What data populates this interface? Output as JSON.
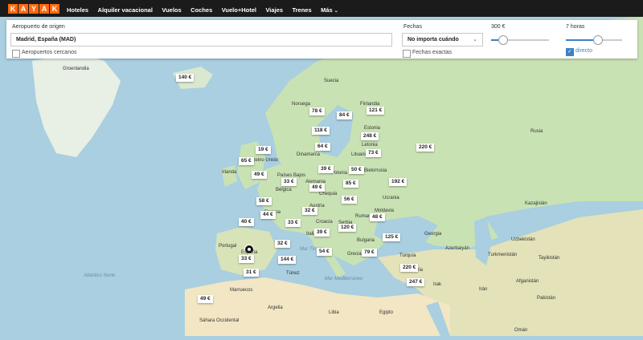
{
  "brand": {
    "letters": [
      "K",
      "A",
      "Y",
      "A",
      "K"
    ]
  },
  "nav": [
    {
      "label": "Hoteles"
    },
    {
      "label": "Alquiler vacacional"
    },
    {
      "label": "Vuelos"
    },
    {
      "label": "Coches"
    },
    {
      "label": "Vuelo+Hotel"
    },
    {
      "label": "Viajes"
    },
    {
      "label": "Trenes"
    },
    {
      "label": "Más"
    }
  ],
  "search": {
    "origin_label": "Aeropuerto de origen",
    "origin_value": "Madrid, España (MAD)",
    "nearby_label": "Aeropuertos cercanos",
    "dates_label": "Fechas",
    "dates_value": "No importa cuándo",
    "exact_dates_label": "Fechas exactas",
    "price_label": "300 €",
    "price_level": 0.2,
    "duration_label": "7 horas",
    "duration_level": 0.55,
    "direct_label": "directo",
    "direct_checked": true
  },
  "colors": {
    "accent": "#ff690f",
    "link": "#3b82c4",
    "water": "#a9cfe0",
    "land": "#c9e2b3",
    "desert": "#f2e6c4"
  },
  "map": {
    "prices": [
      "140 €",
      "78 €",
      "84 €",
      "121 €",
      "118 €",
      "248 €",
      "64 €",
      "73 €",
      "220 €",
      "19 €",
      "65 €",
      "49 €",
      "39 €",
      "50 €",
      "33 €",
      "49 €",
      "85 €",
      "192 €",
      "58 €",
      "56 €",
      "32 €",
      "44 €",
      "48 €",
      "40 €",
      "33 €",
      "120 €",
      "39 €",
      "125 €",
      "32 €",
      "33 €",
      "54 €",
      "79 €",
      "144 €",
      "220 €",
      "31 €",
      "247 €",
      "49 €"
    ],
    "places": [
      "Groenlandia",
      "Suecia",
      "Noruega",
      "Finlandia",
      "Estonia",
      "Letonia",
      "Lituania",
      "Dinamarca",
      "Reino Unido",
      "Irlanda",
      "Países Bajos",
      "Polonia",
      "Bielorrusia",
      "Bélgica",
      "Alemania",
      "Chequia",
      "Ucrania",
      "Austria",
      "Moldavia",
      "Francia",
      "Rumanía",
      "Croacia",
      "Serbia",
      "Italia",
      "Bulgaria",
      "Portugal",
      "España",
      "Grecia",
      "Turquía",
      "Mar Tirreno",
      "Mar Mediterráneo",
      "Túnez",
      "Marruecos",
      "Argelia",
      "Libia",
      "Egipto",
      "Sáhara Occidental",
      "Atlántico Norte",
      "Georgia",
      "Azerbaiyán",
      "Siria",
      "Irak",
      "Irán",
      "Kazajistán",
      "Uzbekistán",
      "Turkmenistán",
      "Tayikistán",
      "Afganistán",
      "Pakistán",
      "Omán",
      "Rusia"
    ]
  }
}
